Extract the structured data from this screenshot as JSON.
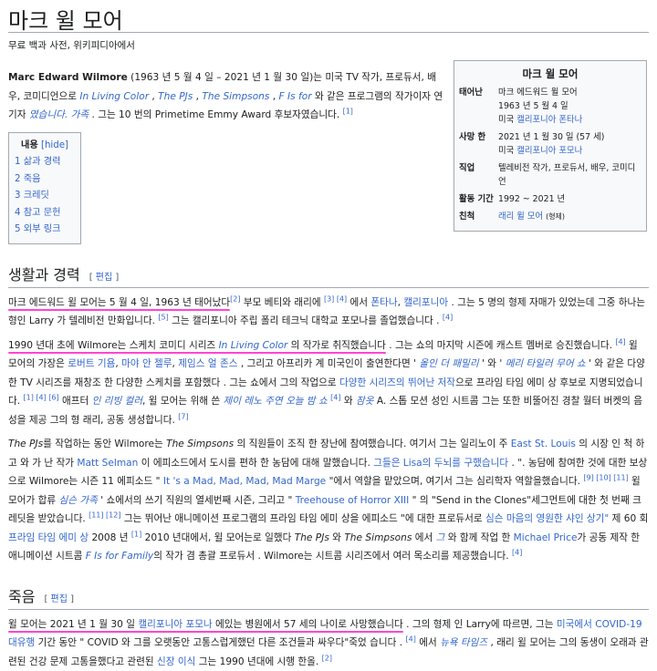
{
  "title": "마크 윌 모어",
  "subtitle": "무료 백과 사전, 위키피디아에서",
  "infobox": {
    "title": "마크 윌 모어",
    "born_label": "태어난",
    "born_name": "마크 에드워드 윌 모어",
    "born_date": "1963 년 5 월 4 일",
    "born_place_prefix": "미국",
    "born_place": "캘리포니아 폰타나",
    "died_label": "사망 한",
    "died_date": "2021 년 1 월 30 일 (57 세)",
    "died_place_prefix": "미국",
    "died_place": "캘리포니아 포모나",
    "job_label": "직업",
    "job_value": "텔레비전 작가, 프로듀서, 배우, 코미디언",
    "active_label": "활동 기간",
    "active_value": "1992 ~ 2021 년",
    "relatives_label": "친척",
    "relatives_value": "래리 윌 모어",
    "relatives_note": "(형제)"
  },
  "intro": {
    "name": "Marc Edward Wilmore",
    "text1": " (1963 년 5 월 4 일 – 2021 년 1 월 30 일)는 미국 TV 작가, 프로듀서, 배우, 코미디언으로 ",
    "show1": "In Living Color",
    "sep1": " , ",
    "show2": "The PJs",
    "sep2": " , ",
    "show3": "The Simpsons",
    "sep3": " , ",
    "show4": "F Is for",
    "text2": " 와 같은 프로그램의 작가이자 연기자 ",
    "show5": "였습니다. 가족",
    "text3": " . 그는 10 번의 Primetime Emmy Award 후보자였습니다.",
    "ref1": "[1]"
  },
  "toc": {
    "label": "내용",
    "hide": "[hide]",
    "items": [
      {
        "num": "1",
        "text": "삶과 경력"
      },
      {
        "num": "2",
        "text": "죽음"
      },
      {
        "num": "3",
        "text": "크레딧"
      },
      {
        "num": "4",
        "text": "참고 문헌"
      },
      {
        "num": "5",
        "text": "외부 링크"
      }
    ]
  },
  "section1": {
    "heading": "생활과 경력",
    "edit": "편집",
    "p1_hl": "마크 에드워드 윌 모어는 5 월 4 일, 1963 년 태어났다",
    "p1_ref": "[2]",
    "p1_a": " 부모 베티와 래리에 ",
    "p1_ref2": "[3] [4]",
    "p1_b": " 에서 ",
    "p1_link1": "폰타나",
    "p1_c": ", ",
    "p1_link2": "캘리포니아",
    "p1_d": " . 그는 5 명의 형제 자매가 있었는데 그중 하나는 형인 Larry 가 텔레비전 만화입니다.",
    "p1_ref3": "[5]",
    "p1_e": " 그는 캘리포니아 주립 폴리 테크닉 대학교 포모나를 졸업했습니다 .",
    "p1_ref4": "[4]",
    "p2_hl_a": "1990 년대 초에 Wilmore는 스케치 코미디 시리즈 ",
    "p2_hl_show": "In Living Color",
    "p2_hl_b": " 의 작가로 취직했습니다",
    "p2_a": " . 그는 쇼의 마지막 시즌에 캐스트 멤버로 승진했습니다.",
    "p2_ref1": "[4]",
    "p2_b": " 윌 모어의 가장은 ",
    "p2_l1": "로버트 기욤",
    "p2_c": ", ",
    "p2_l2": "마야 안 젤루",
    "p2_d": ", ",
    "p2_l3": "제임스 얼 존스",
    "p2_e": " , 그리고 아프리카 계 미국인이 출연한다면 ' ",
    "p2_l4": "올인 더 패밀리",
    "p2_f": " ' 와 ' ",
    "p2_l5": "메리 타일러 무어 쇼",
    "p2_g": " ' 와 같은 다양한 TV 시리즈를 재창조 한 다양한 스케치를 포함했다 . 그는 쇼에서 그의 작업으로 ",
    "p2_l6": "다양한 시리즈의 뛰어난 저작",
    "p2_h": "으로 프라임 타임 에미 상 후보로 지명되었습니다.",
    "p2_ref2": "[1] [4] [6]",
    "p2_i": " 애프터 ",
    "p2_l7": "인 리빙 컬러",
    "p2_j": ", 윌 모어는 위해 쓴 ",
    "p2_l8": "제이 레노 주연 오늘 밤 쇼",
    "p2_ref3": "[4]",
    "p2_k": " 와 ",
    "p2_l9": "잠옷",
    "p2_l": " A. 스톱 모션 성인 시트콤 그는 또한 비뚤어진 경찰 월터 버켓의 음성을 제공 그의 형 래리, 공동 생성합니다.",
    "p2_ref4": "[7]",
    "p3_show1": "The PJs",
    "p3_a": "를 작업하는 동안 Wilmore는 ",
    "p3_show2": "The Simpsons",
    "p3_b": " 의 직원들이 조직 한 장난에 참여했습니다. 여기서 그는 일리노이 주 ",
    "p3_l1": "East St. Louis",
    "p3_c": " 의 시장 인 척 하고 와 가 난 작가 ",
    "p3_l2": "Matt Selman",
    "p3_d": " 이 에피소드에서 도시를 편하 한 농담에 대해 말했습니다. ",
    "p3_l3": "그들은 Lisa의 두뇌를 구했습니다",
    "p3_e": " . \". 농담에 참여한 것에 대한 보상으로 Wilmore는 시즌 11 에피소드 \" ",
    "p3_l4": "It 's a Mad, Mad, Mad, Mad Marge",
    "p3_f": " \"에서 역할을 맡았으며, 여기서 그는 심리학자 역할을했습니다.",
    "p3_ref1": "[9] [10] [11]",
    "p3_g": " 윌 모어가 합류 ",
    "p3_l5": "심슨 가족",
    "p3_h": " ' 쇼에서의 쓰기 직원의 열세번째 시즌, 그리고 \" ",
    "p3_l6": "Treehouse of Horror XIII",
    "p3_i": " \" 의 \"Send in the Clones\"세그먼트에 대한 첫 번째 크레딧을 받았습니다.",
    "p3_ref2": "[11] [12]",
    "p3_j": " 그는 뛰어난 애니메이션 프로그램의 프라임 타임 에미 상을 에피소드 \"에 대한 프로듀서로 ",
    "p3_l7": "심슨 마음의 영원한 샤인 상기\"",
    "p3_k": " 제 60 회 ",
    "p3_l8": "프라임 타임 에미 상",
    "p3_l": " 2008 년 ",
    "p3_ref3": "[1]",
    "p3_m": " 2010 년대에서, 윌 모어는로 일했다 ",
    "p3_show3": "The PJs",
    "p3_n": " 와 ",
    "p3_show4": "The Simpsons",
    "p3_o": " 에서 ",
    "p3_l9": "그",
    "p3_p": " 와 함께 작업 한 ",
    "p3_l10": "Michael Price",
    "p3_q": "가 공동 제작 한 애니메이션 시트콤 ",
    "p3_show5": "F Is for Family",
    "p3_r": "의 작가 겸 총괄 프로듀서 . Wilmore는 시트콤 시리즈에서 여러 목소리를 제공했습니다.",
    "p3_ref4": "[4]"
  },
  "section2": {
    "heading": "죽음",
    "edit": "편집",
    "hl_a": "윌 모어는 2021 년 1 월 30 일 ",
    "hl_link": "캘리포니아 포모나",
    "hl_b": " 에있는 병원에서 57 세의 나이로 사망했습니다",
    "a": " . 그의 형제 인 Larry에 따르면, 그는 ",
    "l1": "미국에서 COVID-19 대유행",
    "b": " 기간 동안 \" COVID 와 그를 오랫동안 고통스럽게했던 다른 조건들과 싸우다\"죽었 습니다 .",
    "ref1": "[4]",
    "c": " 에서 ",
    "l2": "뉴욕 타임즈",
    "d": " , 래리 윌 모어는 그의 동생이 오래과 관련된 건강 문제 고통을했다고 관련된 ",
    "l3": "신장 이식",
    "e": " 그는 1990 년대에 시행 한올.",
    "ref2": "[2]"
  },
  "colors": {
    "link": "#3366cc",
    "highlight": "#ff44d4"
  }
}
